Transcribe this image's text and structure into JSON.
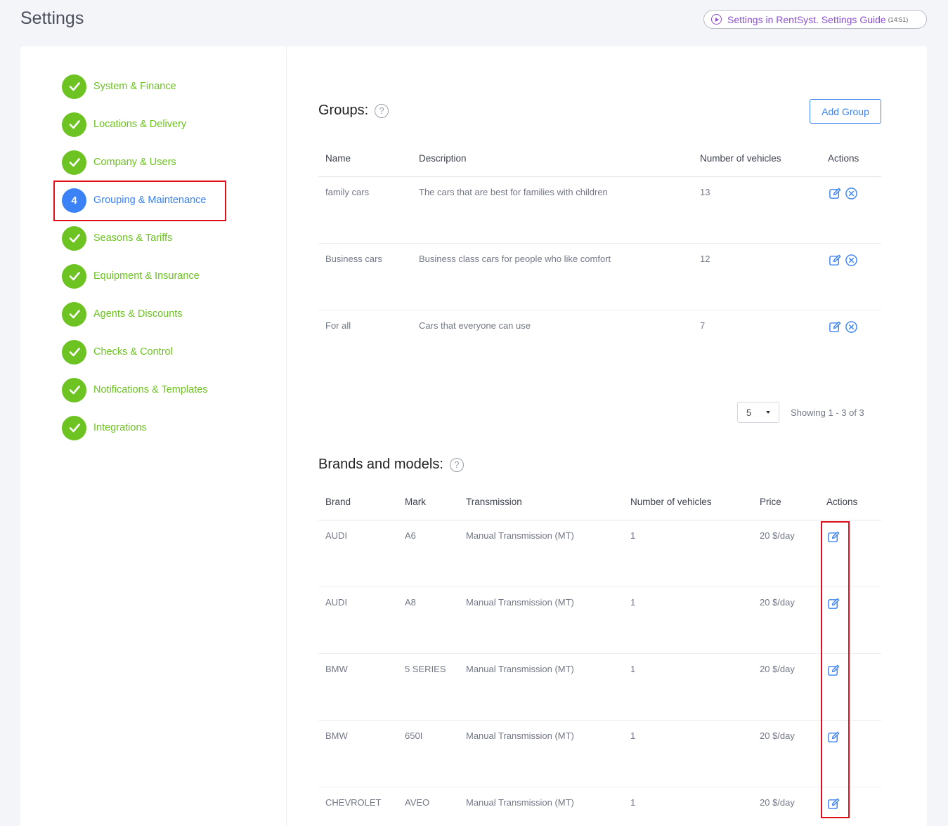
{
  "page": {
    "title": "Settings",
    "guide": {
      "label": "Settings in RentSyst. Settings Guide",
      "duration": "(14:51)"
    }
  },
  "sidebar": {
    "steps": [
      {
        "label": "System & Finance",
        "status": "done"
      },
      {
        "label": "Locations & Delivery",
        "status": "done"
      },
      {
        "label": "Company & Users",
        "status": "done"
      },
      {
        "label": "Grouping & Maintenance",
        "status": "active",
        "number": "4"
      },
      {
        "label": "Seasons & Tariffs",
        "status": "done"
      },
      {
        "label": "Equipment & Insurance",
        "status": "done"
      },
      {
        "label": "Agents & Discounts",
        "status": "done"
      },
      {
        "label": "Checks & Control",
        "status": "done"
      },
      {
        "label": "Notifications & Templates",
        "status": "done"
      },
      {
        "label": "Integrations",
        "status": "done"
      }
    ]
  },
  "groups": {
    "title": "Groups:",
    "help": "?",
    "add_label": "Add Group",
    "columns": [
      "Name",
      "Description",
      "Number of vehicles",
      "Actions"
    ],
    "rows": [
      {
        "name": "family cars",
        "description": "The cars that are best for families with children",
        "vehicles": "13"
      },
      {
        "name": "Business cars",
        "description": "Business class cars for people who like comfort",
        "vehicles": "12"
      },
      {
        "name": "For all",
        "description": "Cars that everyone can use",
        "vehicles": "7"
      }
    ],
    "page_size": "5",
    "showing": "Showing 1 - 3 of 3"
  },
  "brands": {
    "title": "Brands and models:",
    "help": "?",
    "columns": [
      "Brand",
      "Mark",
      "Transmission",
      "Number of vehicles",
      "Price",
      "Actions"
    ],
    "rows": [
      {
        "brand": "AUDI",
        "mark": "A6",
        "transmission": "Manual Transmission (MT)",
        "vehicles": "1",
        "price": "20 $/day"
      },
      {
        "brand": "AUDI",
        "mark": "A8",
        "transmission": "Manual Transmission (MT)",
        "vehicles": "1",
        "price": "20 $/day"
      },
      {
        "brand": "BMW",
        "mark": "5 SERIES",
        "transmission": "Manual Transmission (MT)",
        "vehicles": "1",
        "price": "20 $/day"
      },
      {
        "brand": "BMW",
        "mark": "650I",
        "transmission": "Manual Transmission (MT)",
        "vehicles": "1",
        "price": "20 $/day"
      },
      {
        "brand": "CHEVROLET",
        "mark": "AVEO",
        "transmission": "Manual Transmission (MT)",
        "vehicles": "1",
        "price": "20 $/day"
      }
    ]
  },
  "colors": {
    "accent": "#3b82f6",
    "success": "#6cc321",
    "highlight": "#e0101a",
    "guide": "#8a4fd1"
  }
}
